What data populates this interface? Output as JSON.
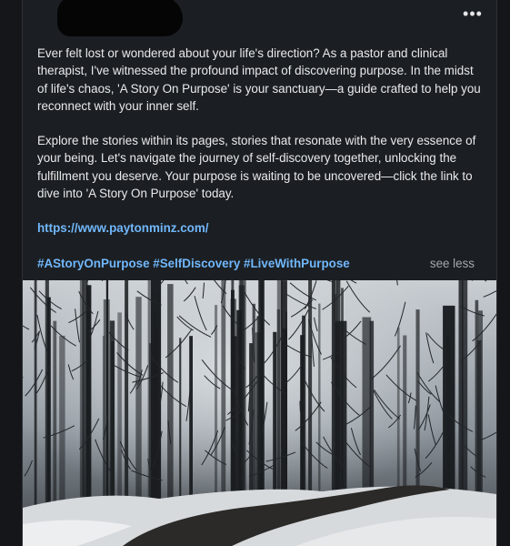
{
  "post": {
    "menu_icon": "more-horizontal-icon",
    "menu_glyph": "•••",
    "paragraph1": "Ever felt lost or wondered about your life's direction? As a pastor and clinical therapist, I've witnessed the profound impact of discovering purpose. In the midst of life's chaos, 'A Story On Purpose' is your sanctuary—a guide crafted to help you reconnect with your inner self.",
    "paragraph2": "Explore the stories within its pages, stories that resonate with the very essence of your being. Let's navigate the journey of self-discovery together, unlocking the fulfillment you deserve. Your purpose is waiting to be uncovered—click the link to dive into 'A Story On Purpose' today.",
    "link": "https://www.paytonminz.com/",
    "hashtags": [
      "#AStoryOnPurpose",
      "#SelfDiscovery",
      "#LiveWithPurpose"
    ],
    "see_less": "see less"
  },
  "colors": {
    "background": "#1b1f23",
    "text": "#e9eaec",
    "link": "#71b7fb",
    "muted": "#a4a8ad"
  }
}
